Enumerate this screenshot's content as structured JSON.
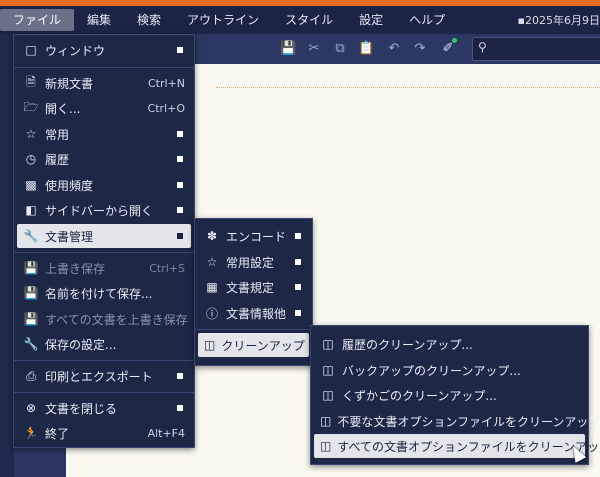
{
  "menubar": {
    "items": [
      "ファイル",
      "編集",
      "検索",
      "アウトライン",
      "スタイル",
      "設定",
      "ヘルプ"
    ],
    "date": "▪2025年6月9日"
  },
  "toolbar": {
    "icons": [
      "save-icon",
      "cut-icon",
      "copy-icon",
      "paste-icon",
      "undo-icon",
      "redo-icon",
      "format-brush-icon"
    ],
    "search_icon": "search-icon"
  },
  "file_menu": {
    "items": [
      {
        "label": "ウィンドウ",
        "icon": "window-icon",
        "shortcut": "",
        "submenu": true,
        "disabled": false,
        "selected": false
      },
      {
        "label": "新規文書",
        "icon": "new-document-icon",
        "shortcut": "Ctrl+N",
        "submenu": false,
        "disabled": false,
        "selected": false
      },
      {
        "label": "開く...",
        "icon": "folder-open-icon",
        "shortcut": "Ctrl+O",
        "submenu": false,
        "disabled": false,
        "selected": false
      },
      {
        "label": "常用",
        "icon": "star-icon",
        "shortcut": "",
        "submenu": true,
        "disabled": false,
        "selected": false
      },
      {
        "label": "履歴",
        "icon": "clock-icon",
        "shortcut": "",
        "submenu": true,
        "disabled": false,
        "selected": false
      },
      {
        "label": "使用頻度",
        "icon": "bar-chart-icon",
        "shortcut": "",
        "submenu": true,
        "disabled": false,
        "selected": false
      },
      {
        "label": "サイドバーから開く",
        "icon": "sidebar-icon",
        "shortcut": "",
        "submenu": true,
        "disabled": false,
        "selected": false
      },
      {
        "label": "文書管理",
        "icon": "wrench-icon",
        "shortcut": "",
        "submenu": true,
        "disabled": false,
        "selected": true
      },
      {
        "label": "上書き保存",
        "icon": "save-icon",
        "shortcut": "Ctrl+S",
        "submenu": false,
        "disabled": true,
        "selected": false
      },
      {
        "label": "名前を付けて保存...",
        "icon": "save-as-icon",
        "shortcut": "",
        "submenu": false,
        "disabled": false,
        "selected": false
      },
      {
        "label": "すべての文書を上書き保存",
        "icon": "save-all-icon",
        "shortcut": "",
        "submenu": false,
        "disabled": true,
        "selected": false
      },
      {
        "label": "保存の設定...",
        "icon": "wrench-icon",
        "shortcut": "",
        "submenu": false,
        "disabled": false,
        "selected": false
      },
      {
        "label": "印刷とエクスポート",
        "icon": "print-icon",
        "shortcut": "",
        "submenu": true,
        "disabled": false,
        "selected": false
      },
      {
        "label": "文書を閉じる",
        "icon": "close-circle-icon",
        "shortcut": "",
        "submenu": true,
        "disabled": false,
        "selected": false
      },
      {
        "label": "終了",
        "icon": "exit-icon",
        "shortcut": "Alt+F4",
        "submenu": false,
        "disabled": false,
        "selected": false
      }
    ]
  },
  "doc_menu": {
    "items": [
      {
        "label": "エンコード",
        "icon": "encoding-icon"
      },
      {
        "label": "常用設定",
        "icon": "star-icon"
      },
      {
        "label": "文書規定",
        "icon": "document-rules-icon"
      },
      {
        "label": "文書情報他",
        "icon": "info-icon"
      },
      {
        "label": "クリーンアップ",
        "icon": "eraser-icon"
      }
    ]
  },
  "cleanup_menu": {
    "items": [
      {
        "label": "履歴のクリーンアップ...",
        "icon": "eraser-icon"
      },
      {
        "label": "バックアップのクリーンアップ...",
        "icon": "eraser-icon"
      },
      {
        "label": "くずかごのクリーンアップ...",
        "icon": "eraser-icon"
      },
      {
        "label": "不要な文書オプションファイルをクリーンアップ...",
        "icon": "eraser-icon"
      },
      {
        "label": "すべての文書オプションファイルをクリーンアップ...",
        "icon": "eraser-icon"
      }
    ]
  }
}
